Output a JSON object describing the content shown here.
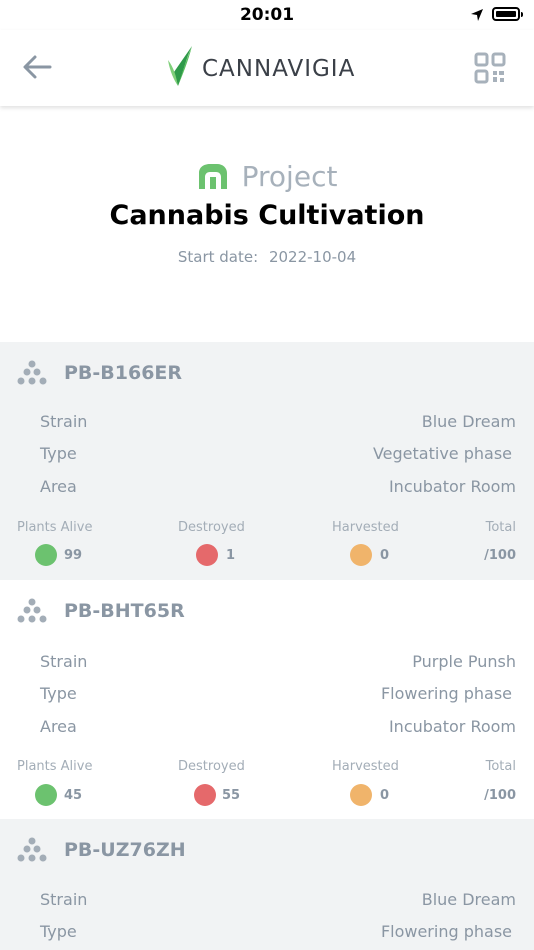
{
  "status_bar": {
    "time": "20:01"
  },
  "nav": {
    "logo_text": "CANNAVIGIA"
  },
  "project": {
    "label": "Project",
    "title": "Cannabis Cultivation",
    "start_date_label": "Start date:",
    "start_date": "2022-10-04"
  },
  "colors": {
    "alive": "#6cc26f",
    "destroyed": "#e5696b",
    "harvested": "#f0b46b",
    "brand_green": "#6cc26f"
  },
  "labels": {
    "strain": "Strain",
    "type": "Type",
    "area": "Area",
    "plants_alive": "Plants Alive",
    "destroyed": "Destroyed",
    "harvested": "Harvested",
    "total": "Total"
  },
  "batches": [
    {
      "id": "PB-B166ER",
      "strain": "Blue Dream",
      "type": "Vegetative phase",
      "area": "Incubator Room",
      "alive": "99",
      "destroyed": "1",
      "harvested": "0",
      "total": "/100"
    },
    {
      "id": "PB-BHT65R",
      "strain": "Purple Punsh",
      "type": "Flowering phase",
      "area": "Incubator Room",
      "alive": "45",
      "destroyed": "55",
      "harvested": "0",
      "total": "/100"
    },
    {
      "id": "PB-UZ76ZH",
      "strain": "Blue Dream",
      "type": "Flowering phase",
      "area": "",
      "alive": "",
      "destroyed": "",
      "harvested": "",
      "total": ""
    }
  ]
}
